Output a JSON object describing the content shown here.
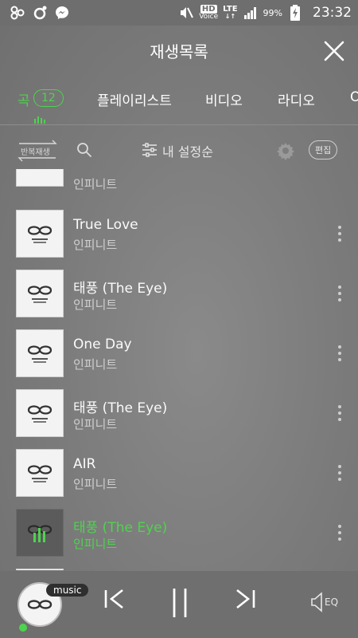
{
  "status_bar": {
    "time": "23:32",
    "battery": "99%",
    "hd_label": "HD",
    "voice_label": "Voice",
    "network": "LTE"
  },
  "header": {
    "title": "재생목록"
  },
  "tabs": [
    {
      "label": "곡",
      "count": "12",
      "active": true
    },
    {
      "label": "플레이리스트"
    },
    {
      "label": "비디오"
    },
    {
      "label": "라디오"
    },
    {
      "label": "O"
    }
  ],
  "toolbar": {
    "repeat_label": "반복재생",
    "sort_label": "내 설정순",
    "edit_label": "편집"
  },
  "songs": [
    {
      "title": "",
      "artist": "인피니트"
    },
    {
      "title": "True Love",
      "artist": "인피니트"
    },
    {
      "title": "태풍 (The Eye)",
      "artist": "인피니트"
    },
    {
      "title": "One Day",
      "artist": "인피니트"
    },
    {
      "title": "태풍 (The Eye)",
      "artist": "인피니트"
    },
    {
      "title": "AIR",
      "artist": "인피니트"
    },
    {
      "title": "태풍 (The Eye)",
      "artist": "인피니트",
      "playing": true
    }
  ],
  "player": {
    "badge": "music",
    "eq_label": "EQ"
  },
  "colors": {
    "accent": "#4ed34e",
    "background": "#7d7d7d"
  }
}
